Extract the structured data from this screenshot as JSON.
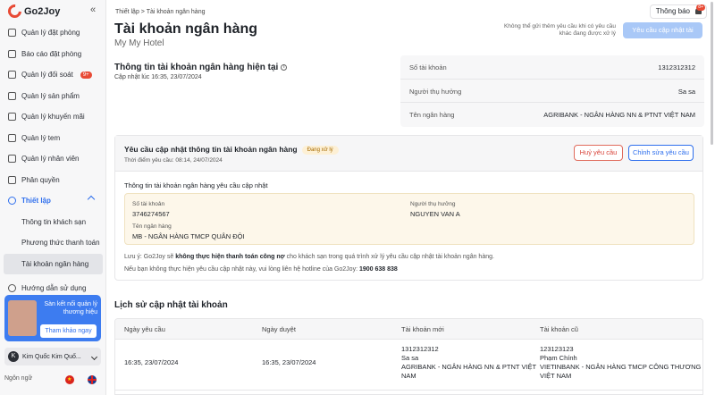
{
  "brand": {
    "name": "Go2Joy"
  },
  "sidebar": {
    "items": [
      {
        "label": "Quản lý đặt phòng"
      },
      {
        "label": "Báo cáo đặt phòng"
      },
      {
        "label": "Quản lý đối soát",
        "badge": "9+"
      },
      {
        "label": "Quản lý sản phẩm"
      },
      {
        "label": "Quản lý khuyến mãi"
      },
      {
        "label": "Quản lý tem"
      },
      {
        "label": "Quản lý nhân viên"
      },
      {
        "label": "Phân quyền"
      }
    ],
    "group": {
      "label": "Thiết lập"
    },
    "sub_items": [
      {
        "label": "Thông tin khách sạn"
      },
      {
        "label": "Phương thức thanh toán"
      },
      {
        "label": "Tài khoản ngân hàng"
      }
    ],
    "guide": {
      "label": "Hướng dẫn sử dụng"
    },
    "promo": {
      "text": "Sàn kết nối quản lý thương hiệu",
      "button": "Tham khảo ngay"
    },
    "user": {
      "initial": "K",
      "name": "Kim Quốc Kim Quố..."
    },
    "language": {
      "label": "Ngôn ngữ"
    }
  },
  "header": {
    "breadcrumb": "Thiết lập  >  Tài khoản ngân hàng",
    "notification": {
      "label": "Thông báo",
      "count": "8+"
    },
    "title": "Tài khoản ngân hàng",
    "hotel": "My My Hotel",
    "warning": "Không thể gửi thêm yêu cầu khi có yêu cầu khác đang được xử lý",
    "request_button": "Yêu cầu cập nhật tài khoản"
  },
  "current": {
    "title": "Thông tin tài khoản ngân hàng hiện tại",
    "updated": "Cập nhật lúc 16:35, 23/07/2024",
    "rows": [
      {
        "label": "Số tài khoản",
        "value": "1312312312"
      },
      {
        "label": "Người thụ hưởng",
        "value": "Sa sa"
      },
      {
        "label": "Tên ngân hàng",
        "value": "AGRIBANK - NGÂN HÀNG NN & PTNT VIỆT NAM"
      }
    ]
  },
  "request": {
    "title": "Yêu cầu cập nhật thông tin tài khoản ngân hàng",
    "status": "Đang xử lý",
    "time": "Thời điểm yêu cầu: 08:14, 24/07/2024",
    "cancel_button": "Huỷ yêu cầu",
    "edit_button": "Chỉnh sửa yêu cầu",
    "update_label": "Thông tin tài khoản ngân hàng yêu cầu cập nhật",
    "fields": {
      "account_label": "Số tài khoản",
      "account_value": "3746274567",
      "beneficiary_label": "Người thụ hưởng",
      "beneficiary_value": "NGUYEN VAN A",
      "bank_label": "Tên ngân hàng",
      "bank_value": "MB - NGÂN HÀNG TMCP QUÂN ĐỘI"
    },
    "note_prefix": "Lưu ý: Go2Joy sẽ ",
    "note_bold": "không thực hiện thanh toán công nợ",
    "note_suffix": " cho khách sạn trong quá trình xử lý yêu cầu cập nhật tài khoản ngân hàng.",
    "note2_prefix": "Nếu bạn không thực hiện yêu cầu cập nhật này, vui lòng liên hệ hotline của Go2Joy: ",
    "note2_hotline": "1900 638 838"
  },
  "history": {
    "title": "Lịch sử cập nhật tài khoản",
    "columns": [
      "Ngày yêu cầu",
      "Ngày duyệt",
      "Tài khoản mới",
      "Tài khoản cũ"
    ],
    "rows": [
      {
        "requested": "16:35, 23/07/2024",
        "approved": "16:35, 23/07/2024",
        "new_account": "1312312312",
        "new_name": "Sa sa",
        "new_bank": "AGRIBANK - NGÂN HÀNG NN & PTNT VIỆT",
        "new_bank_2": "NAM",
        "old_account": "123123123",
        "old_name": "Phạm Chính",
        "old_bank": "VIETINBANK - NGÂN HÀNG TMCP CÔNG THƯƠNG",
        "old_bank_2": "VIỆT NAM"
      }
    ]
  }
}
